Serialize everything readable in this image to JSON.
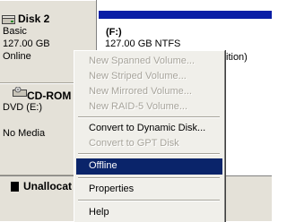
{
  "disks": [
    {
      "name": "Disk 2",
      "type": "Basic",
      "size": "127.00 GB",
      "status": "Online"
    },
    {
      "name": "CD-ROM",
      "drive": "DVD (E:)",
      "status": "No Media"
    }
  ],
  "volume": {
    "title": "(F:)",
    "size_fs": "127.00 GB NTFS",
    "status_partial": "ition)"
  },
  "legend": {
    "label": "Unallocat"
  },
  "context_menu": {
    "items": [
      {
        "label": "New Spanned Volume...",
        "enabled": false
      },
      {
        "label": "New Striped Volume...",
        "enabled": false
      },
      {
        "label": "New Mirrored Volume...",
        "enabled": false
      },
      {
        "label": "New RAID-5 Volume...",
        "enabled": false
      },
      {
        "label": "Convert to Dynamic Disk...",
        "enabled": true
      },
      {
        "label": "Convert to GPT Disk",
        "enabled": false
      },
      {
        "label": "Offline",
        "enabled": true,
        "selected": true
      },
      {
        "label": "Properties",
        "enabled": true
      },
      {
        "label": "Help",
        "enabled": true
      }
    ]
  },
  "colors": {
    "volume_header": "#0a1ea6",
    "selection": "#0a246a",
    "panel_bg": "#e4e1d8",
    "disabled_text": "#a7a49b"
  }
}
